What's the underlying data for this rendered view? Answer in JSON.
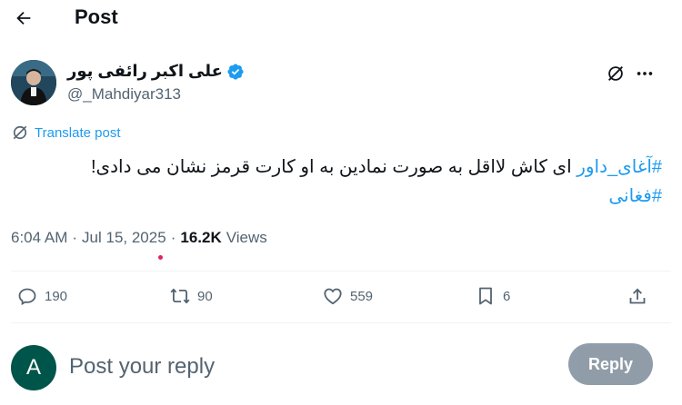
{
  "header": {
    "title": "Post"
  },
  "author": {
    "name": "علی اکبر رائفی پور",
    "handle": "@_Mahdiyar313"
  },
  "translate_label": "Translate post",
  "tweet": {
    "hashtag1": "#آغای_داور",
    "text": " ای کاش لااقل به صورت نمادین به او کارت قرمز نشان می دادی!",
    "hashtag2": "#فغانی"
  },
  "meta": {
    "time": "6:04 AM",
    "date": "Jul 15, 2025",
    "views_count": "16.2K",
    "views_label": "Views"
  },
  "actions": {
    "replies": "190",
    "reposts": "90",
    "likes": "559",
    "bookmarks": "6"
  },
  "reply_box": {
    "avatar_letter": "A",
    "placeholder": "Post your reply",
    "button_label": "Reply"
  },
  "colors": {
    "accent": "#1d9bf0",
    "text_secondary": "#536471",
    "reply_button_disabled": "#8b98a5",
    "avatar_reply": "#00554a"
  }
}
